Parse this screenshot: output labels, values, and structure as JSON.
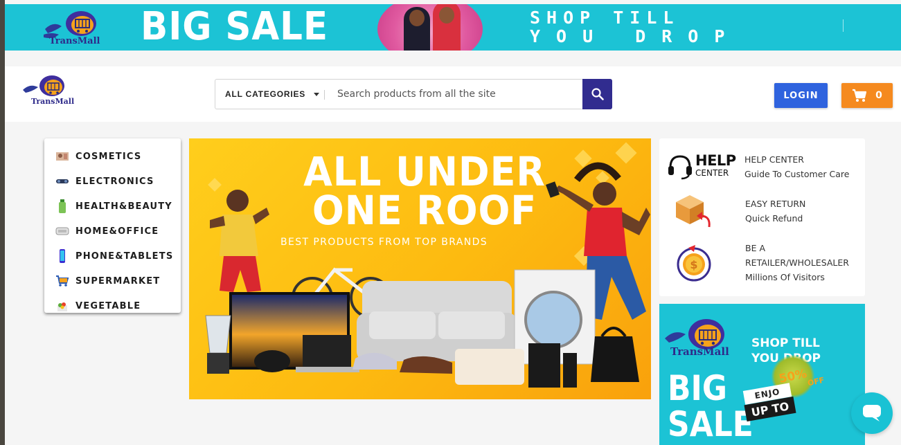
{
  "top_banner": {
    "brand": "TransMall",
    "headline": "BIG SALE",
    "tagline_line1": "SHOP TILL",
    "tagline_line2": "YOU DROP"
  },
  "header": {
    "logo_text": "TransMall",
    "search": {
      "category_label": "ALL CATEGORIES",
      "placeholder": "Search products from all the site"
    },
    "login_label": "LOGIN",
    "cart_count": "0"
  },
  "categories": [
    {
      "label": "COSMETICS",
      "icon": "cosmetics-icon"
    },
    {
      "label": "ELECTRONICS",
      "icon": "electronics-icon"
    },
    {
      "label": "HEALTH&BEAUTY",
      "icon": "health-beauty-icon"
    },
    {
      "label": "HOME&OFFICE",
      "icon": "home-office-icon"
    },
    {
      "label": "PHONE&TABLETS",
      "icon": "phone-tablets-icon"
    },
    {
      "label": "SUPERMARKET",
      "icon": "supermarket-icon"
    },
    {
      "label": "VEGETABLE",
      "icon": "vegetable-icon"
    }
  ],
  "hero": {
    "title_line1": "ALL UNDER",
    "title_line2": "ONE ROOF",
    "subtitle": "BEST PRODUCTS FROM TOP BRANDS"
  },
  "info": {
    "help": {
      "badge_big": "HELP",
      "badge_small": "CENTER",
      "title": "HELP CENTER",
      "subtitle": "Guide To Customer Care"
    },
    "returns": {
      "title": "EASY RETURN",
      "subtitle": "Quick Refund"
    },
    "retailer": {
      "title_line1": "BE A",
      "title_line2": "RETAILER/WHOLESALER",
      "subtitle": "Millions Of Visitors"
    }
  },
  "promo": {
    "brand": "TransMall",
    "shop_line1": "SHOP TILL",
    "shop_line2": "YOU DROP",
    "big_line1": "BIG",
    "big_line2": "SALE",
    "discount": "50%",
    "discount_suffix": "OFF",
    "enjoy": "ENJO",
    "upto": "UP TO"
  },
  "colors": {
    "banner_cyan": "#1cc3d5",
    "search_button": "#312c8f",
    "login_blue": "#2f63de",
    "cart_orange": "#f58a1f",
    "hero_yellow": "#fdba10"
  }
}
